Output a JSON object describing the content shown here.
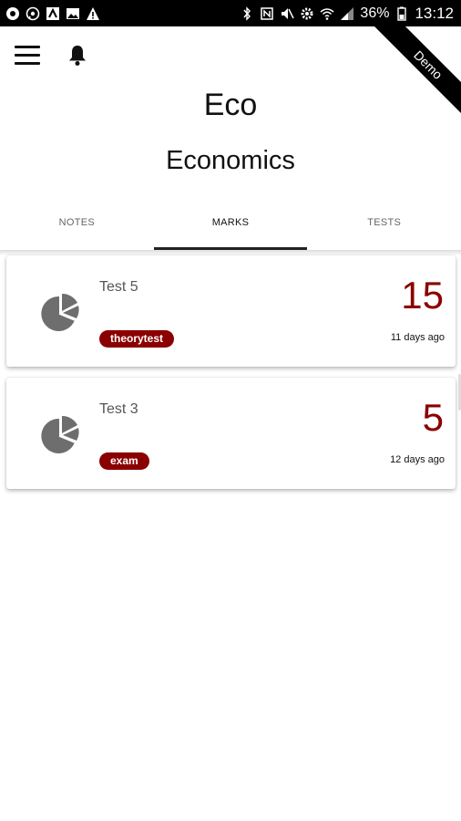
{
  "status_bar": {
    "battery": "36%",
    "time": "13:12"
  },
  "ribbon": {
    "label": "Demo"
  },
  "course": {
    "short_name": "Eco",
    "name": "Economics"
  },
  "tabs": [
    {
      "label": "NOTES",
      "active": false
    },
    {
      "label": "MARKS",
      "active": true
    },
    {
      "label": "TESTS",
      "active": false
    }
  ],
  "marks": [
    {
      "title": "Test 5",
      "tag": "theorytest",
      "score": "15",
      "time": "11 days ago"
    },
    {
      "title": "Test 3",
      "tag": "exam",
      "score": "5",
      "time": "12 days ago"
    }
  ],
  "colors": {
    "accent": "#8b0000",
    "status_bar": "#000000",
    "icon_gray": "#6e6e6e"
  },
  "icons": {
    "menu": "hamburger-icon",
    "notifications": "bell-icon",
    "mark_item": "pie-chart-icon"
  }
}
